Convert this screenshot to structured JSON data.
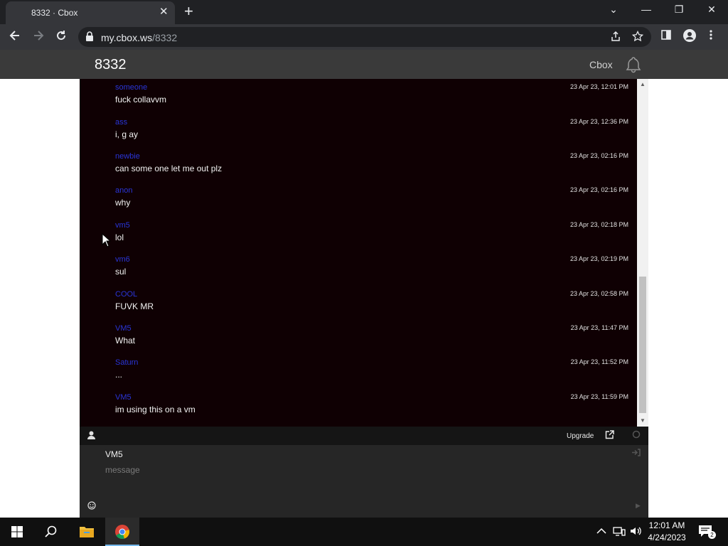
{
  "browser": {
    "tab_title": "8332 · Cbox",
    "tab_close": "✕",
    "new_tab": "+",
    "url_host": "my.cbox.ws",
    "url_path": "/8332",
    "window_controls": [
      "⌄",
      "—",
      "❐",
      "✕"
    ]
  },
  "site": {
    "title": "8332",
    "brand": "Cbox"
  },
  "messages": [
    {
      "name": "someone",
      "text": "fuck collavvm",
      "time": "23 Apr 23, 12:01 PM"
    },
    {
      "name": "ass",
      "text": "i, g ay",
      "time": "23 Apr 23, 12:36 PM"
    },
    {
      "name": "newbie",
      "text": "can some one let me out plz",
      "time": "23 Apr 23, 02:16 PM"
    },
    {
      "name": "anon",
      "text": "why",
      "time": "23 Apr 23, 02:16 PM"
    },
    {
      "name": "vm5",
      "text": "lol",
      "time": "23 Apr 23, 02:18 PM"
    },
    {
      "name": "vm6",
      "text": "sul",
      "time": "23 Apr 23, 02:19 PM"
    },
    {
      "name": "COOL",
      "text": "FUVK MR",
      "time": "23 Apr 23, 02:58 PM"
    },
    {
      "name": "VM5",
      "text": "What",
      "time": "23 Apr 23, 11:47 PM"
    },
    {
      "name": "Saturn",
      "text": "...",
      "time": "23 Apr 23, 11:52 PM"
    },
    {
      "name": "VM5",
      "text": "im using this on a vm",
      "time": "23 Apr 23, 11:59 PM"
    }
  ],
  "actions": {
    "upgrade": "Upgrade"
  },
  "composer": {
    "name": "VM5",
    "message_placeholder": "message"
  },
  "taskbar": {
    "time": "12:01 AM",
    "date": "4/24/2023",
    "notification_count": "2"
  },
  "colors": {
    "chat_bg": "#0f0003",
    "username": "#2a35d8",
    "header_bg": "#3a3a3a",
    "composer_bg": "#262626"
  }
}
